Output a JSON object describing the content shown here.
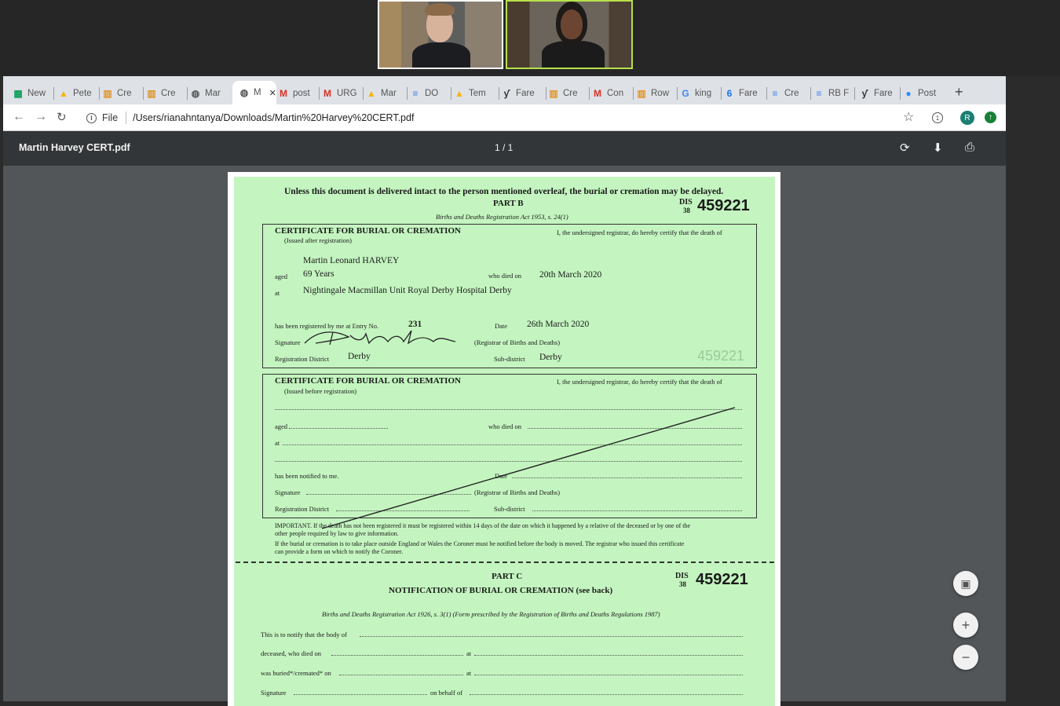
{
  "tabs": [
    {
      "label": "New",
      "icon": "sheets-icon",
      "color": "#0f9d58"
    },
    {
      "label": "Pete",
      "icon": "drive-icon",
      "color": "#f4b400"
    },
    {
      "label": "Cre",
      "icon": "calendar-icon",
      "color": "#e69522"
    },
    {
      "label": "Cre",
      "icon": "calendar-icon",
      "color": "#e69522"
    },
    {
      "label": "Mar",
      "icon": "globe-icon",
      "color": "#555555"
    },
    {
      "label": "M",
      "icon": "globe-icon",
      "color": "#555555"
    },
    {
      "label": "post",
      "icon": "gmail-icon",
      "color": "#d93025"
    },
    {
      "label": "URG",
      "icon": "gmail-icon",
      "color": "#d93025"
    },
    {
      "label": "Mar",
      "icon": "drive-icon",
      "color": "#f4b400"
    },
    {
      "label": "DO",
      "icon": "docs-icon",
      "color": "#4285f4"
    },
    {
      "label": "Tem",
      "icon": "drive-icon",
      "color": "#f4b400"
    },
    {
      "label": "Fare",
      "icon": "yeti-icon",
      "color": "#333333"
    },
    {
      "label": "Cre",
      "icon": "calendar-icon",
      "color": "#e69522"
    },
    {
      "label": "Con",
      "icon": "gmail-icon",
      "color": "#d93025"
    },
    {
      "label": "Row",
      "icon": "calendar-icon",
      "color": "#e69522"
    },
    {
      "label": "king",
      "icon": "google-icon",
      "color": "#4285f4"
    },
    {
      "label": "Fare",
      "icon": "calendar-6-icon",
      "color": "#1a73e8"
    },
    {
      "label": "Cre",
      "icon": "docs-icon",
      "color": "#4285f4"
    },
    {
      "label": "RB F",
      "icon": "docs-icon",
      "color": "#4285f4"
    },
    {
      "label": "Fare",
      "icon": "yeti-icon",
      "color": "#333333"
    },
    {
      "label": "Post",
      "icon": "zoom-icon",
      "color": "#2d8cff"
    }
  ],
  "address": {
    "scheme": "File",
    "url": "/Users/rianahntanya/Downloads/Martin%20Harvey%20CERT.pdf"
  },
  "profile_initial": "R",
  "pdf": {
    "title": "Martin Harvey CERT.pdf",
    "page_count": "1 / 1"
  },
  "cert": {
    "warning": "Unless this document is delivered intact to the person mentioned overleaf, the burial or cremation may be delayed.",
    "part_b": "PART B",
    "part_b_act": "Births and Deaths Registration Act 1953, s. 24(1)",
    "dis": "DIS",
    "dis_num": "38",
    "serial": "459221",
    "serial_faint": "459221",
    "box1_heading": "CERTIFICATE FOR BURIAL OR CREMATION",
    "box1_sub": "(Issued after registration)",
    "certify": "I, the undersigned registrar, do hereby certify that the death of",
    "name": "Martin Leonard HARVEY",
    "aged_label": "aged",
    "age": "69 Years",
    "died_label": "who died on",
    "died": "20th March 2020",
    "at_label": "at",
    "place": "Nightingale Macmillan Unit Royal Derby Hospital Derby",
    "registered_label": "has been registered by me at Entry No.",
    "entry_no": "231",
    "date_label": "Date",
    "date": "26th March 2020",
    "signature_label": "Signature",
    "registrar_label": "(Registrar of Births and Deaths)",
    "district_label": "Registration District",
    "district": "Derby",
    "subdistrict_label": "Sub-district",
    "subdistrict": "Derby",
    "box2_sub": "(Issued before registration)",
    "notified_label": "has been notified to me.",
    "important": "IMPORTANT. If the death has not been registered it must be registered within 14 days of the date on which it happened by a relative of the deceased or by one of the",
    "important2": "other people required by law to give information.",
    "outside": "If the burial or cremation is to take place outside England or Wales the Coroner must be notified before the body is moved. The registrar who issued this certificate",
    "outside2": "can provide a form on which to notify the Coroner.",
    "part_c": "PART C",
    "notification": "NOTIFICATION OF BURIAL OR CREMATION (see back)",
    "part_c_act": "Births and Deaths Registration Act 1926, s. 3(1) (Form prescribed by the Registration of Births and Deaths Regulations 1987)",
    "notify_body": "This is to notify that the body of",
    "deceased_label": "deceased, who died on",
    "at2": "at",
    "buried_label": "was buried*/cremated* on",
    "at3": "at",
    "sig2": "Signature",
    "behalf": "on behalf of"
  }
}
